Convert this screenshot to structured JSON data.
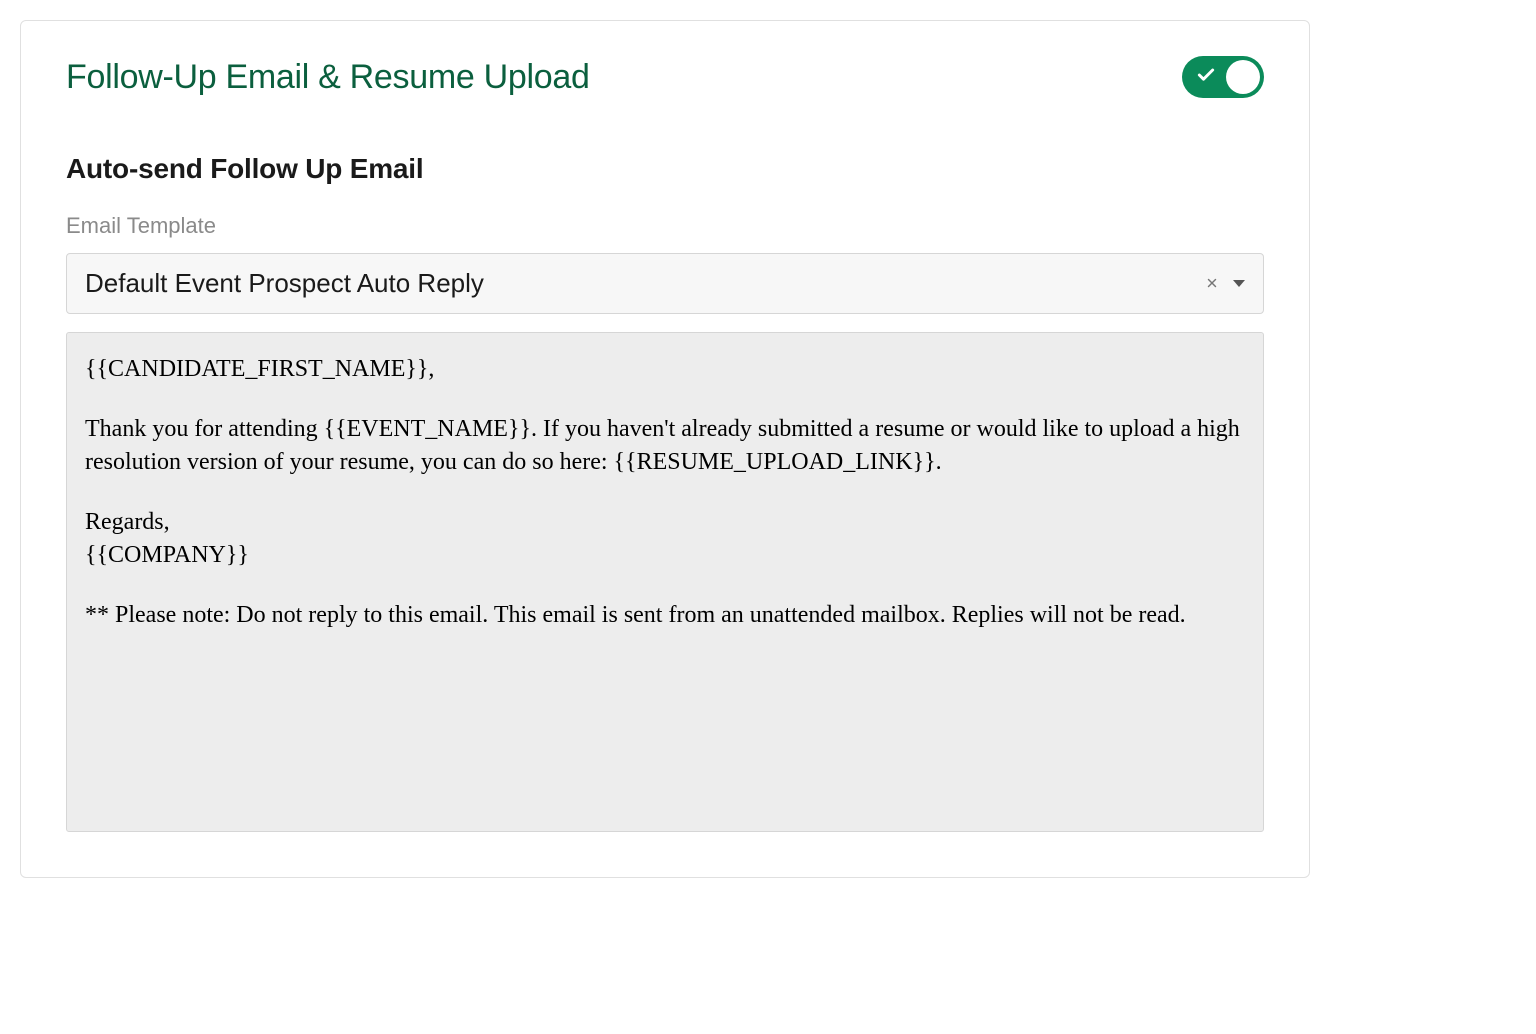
{
  "card": {
    "title": "Follow-Up Email & Resume Upload",
    "toggle_on": true
  },
  "section": {
    "title": "Auto-send Follow Up Email"
  },
  "template_field": {
    "label": "Email Template",
    "selected": "Default Event Prospect Auto Reply"
  },
  "preview": {
    "greeting": "{{CANDIDATE_FIRST_NAME}},",
    "body": "Thank you for attending {{EVENT_NAME}}. If you haven't already submitted a resume or would like to upload a high resolution version of your resume, you can do so here: {{RESUME_UPLOAD_LINK}}.",
    "signoff_line1": "Regards,",
    "signoff_line2": "{{COMPANY}}",
    "footer": "** Please note: Do not reply to this email. This email is sent from an unattended mailbox. Replies will not be read."
  }
}
